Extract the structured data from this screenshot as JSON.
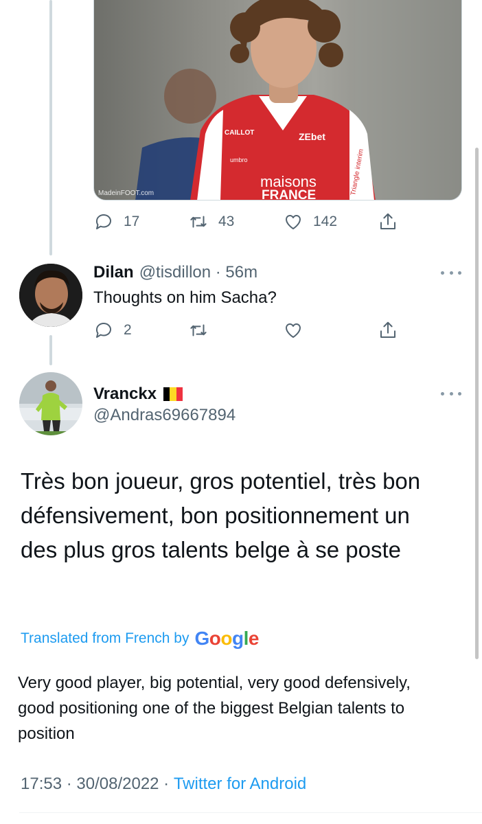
{
  "media": {
    "credit": "MadeinFOOT.com",
    "jersey": {
      "sponsor_main_1": "maisons",
      "sponsor_main_2": "FRANCE",
      "sponsor_chest": "ZEbet",
      "brand_left": "CAILLOT",
      "kit_maker": "umbro",
      "sleeve": "Triangle interim"
    }
  },
  "tweet1_actions": {
    "replies": "17",
    "retweets": "43",
    "likes": "142"
  },
  "reply": {
    "name": "Dilan",
    "handle": "@tisdillon",
    "sep": " · ",
    "time": "56m",
    "text": "Thoughts on him Sacha?",
    "replies": "2"
  },
  "main_tweet": {
    "name": "Vranckx",
    "handle": "@Andras69667894",
    "text": "Très bon joueur, gros potentiel, très bon défensivement, bon positionnement un des plus gros talents belge à se poste",
    "translated_label": "Translated from French by",
    "translator": "Google",
    "translation": "Very good player, big potential, very good defensively, good positioning one of the biggest Belgian talents to position",
    "time": "17:53",
    "date": "30/08/2022",
    "sep": " · ",
    "source": "Twitter for Android"
  },
  "colors": {
    "accent": "#1d9bf0",
    "secondary": "#536471",
    "jersey_red": "#d42a2f"
  }
}
